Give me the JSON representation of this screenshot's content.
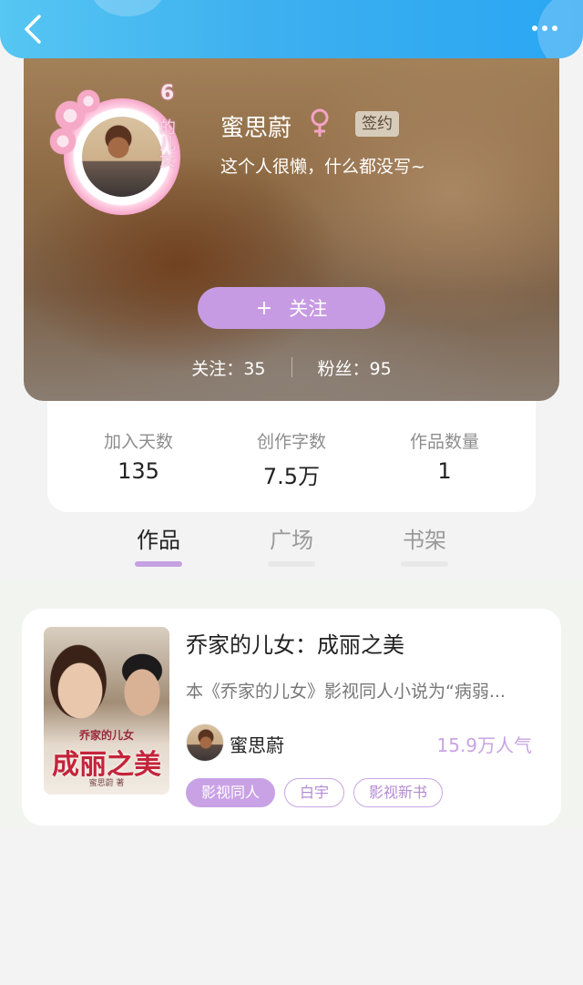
{
  "nav": {
    "back_icon": "chevron-left-icon",
    "more_icon": "more-horizontal-icon"
  },
  "profile": {
    "name": "蜜思蔚",
    "gender_icon": "female-icon",
    "badge": "签约",
    "bio": "这个人很懒，什么都没写~",
    "avatar_frame_text": "6",
    "avatar_frame_subtext": "的儿女",
    "follow_plus": "+",
    "follow_label": "关注",
    "following_label": "关注：",
    "following_count": "35",
    "fans_label": "粉丝：",
    "fans_count": "95"
  },
  "stats": [
    {
      "label": "加入天数",
      "value": "135"
    },
    {
      "label": "创作字数",
      "value": "7.5万"
    },
    {
      "label": "作品数量",
      "value": "1"
    }
  ],
  "tabs": [
    {
      "label": "作品",
      "active": true
    },
    {
      "label": "广场",
      "active": false
    },
    {
      "label": "书架",
      "active": false
    }
  ],
  "work": {
    "title": "乔家的儿女：成丽之美",
    "description": "本《乔家的儿女》影视同人小说为“病弱...",
    "author": "蜜思蔚",
    "popularity": "15.9万人气",
    "cover_title": "成丽之美",
    "cover_subtitle": "乔家的儿女",
    "cover_author": "蜜思蔚 著",
    "tags": [
      "影视同人",
      "白宇",
      "影视新书"
    ]
  },
  "colors": {
    "topbar": "#3db0f0",
    "accent": "#c79be3",
    "badge_bg": "#d7ccba"
  }
}
